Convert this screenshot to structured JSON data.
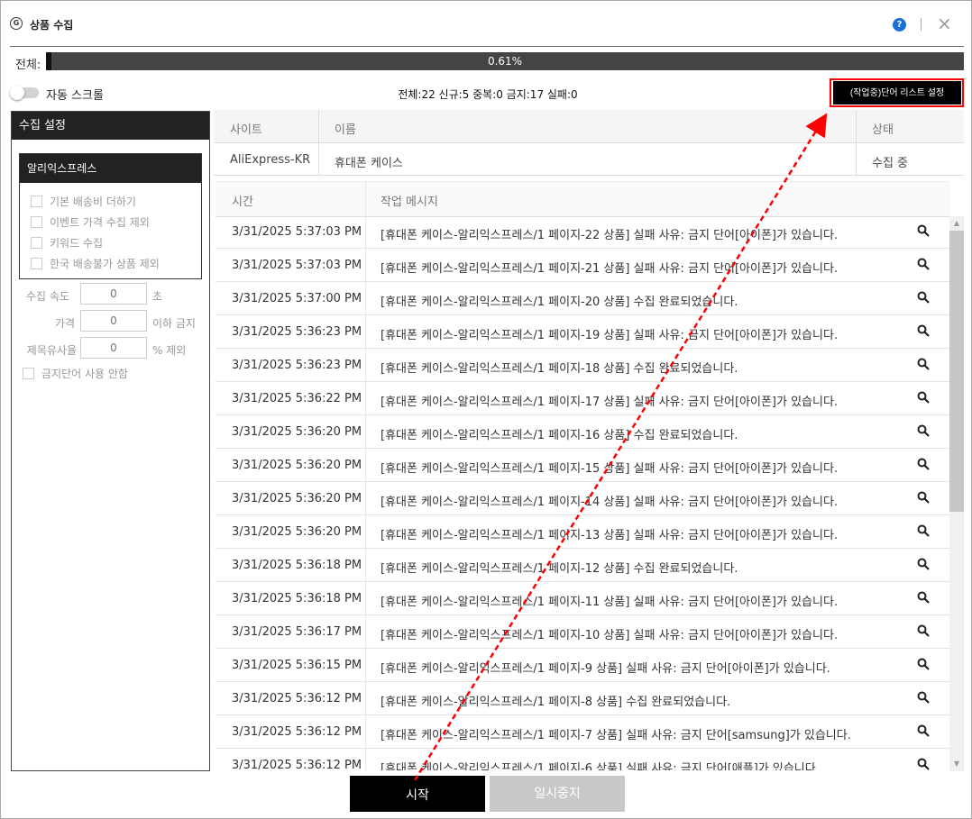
{
  "window": {
    "title": "상품 수집",
    "help_icon": "?",
    "close_icon": "×"
  },
  "progress": {
    "label": "전체:",
    "percent_text": "0.61%",
    "fraction": 0.0061
  },
  "toolbar": {
    "auto_scroll_label": "자동 스크롤",
    "auto_scroll_on": false,
    "stats": "전체:22 신규:5 중복:0 금지:17 실패:0",
    "wordlist_button": "(작업중)단어 리스트 설정"
  },
  "settings": {
    "title": "수집 설정",
    "source_title": "알리익스프레스",
    "options": [
      "기본 배송비 더하기",
      "이벤트 가격 수집 제외",
      "키워드 수집",
      "한국 배송불가 상품 제외"
    ],
    "fields": [
      {
        "label": "수집 속도",
        "value": "0",
        "unit": "초"
      },
      {
        "label": "가격",
        "value": "0",
        "unit": "이하 금지"
      },
      {
        "label": "제목유사율",
        "value": "0",
        "unit": "% 제외"
      }
    ],
    "disable_banned": "금지단어 사용 안함"
  },
  "site_table": {
    "headers": {
      "site": "사이트",
      "name": "이름",
      "status": "상태"
    },
    "row": {
      "site": "AliExpress-KR",
      "name": "휴대폰 케이스",
      "status": "수집 중"
    }
  },
  "log_table": {
    "headers": {
      "time": "시간",
      "message": "작업 메시지"
    },
    "rows": [
      {
        "time": "3/31/2025 5:37:03 PM",
        "message": "[휴대폰 케이스-알리익스프레스/1 페이지-22 상품] 실패 사유: 금지 단어[아이폰]가 있습니다."
      },
      {
        "time": "3/31/2025 5:37:03 PM",
        "message": "[휴대폰 케이스-알리익스프레스/1 페이지-21 상품] 실패 사유: 금지 단어[아이폰]가 있습니다."
      },
      {
        "time": "3/31/2025 5:37:00 PM",
        "message": "[휴대폰 케이스-알리익스프레스/1 페이지-20 상품] 수집 완료되었습니다."
      },
      {
        "time": "3/31/2025 5:36:23 PM",
        "message": "[휴대폰 케이스-알리익스프레스/1 페이지-19 상품] 실패 사유: 금지 단어[아이폰]가 있습니다."
      },
      {
        "time": "3/31/2025 5:36:23 PM",
        "message": "[휴대폰 케이스-알리익스프레스/1 페이지-18 상품] 수집 완료되었습니다."
      },
      {
        "time": "3/31/2025 5:36:22 PM",
        "message": "[휴대폰 케이스-알리익스프레스/1 페이지-17 상품] 실패 사유: 금지 단어[아이폰]가 있습니다."
      },
      {
        "time": "3/31/2025 5:36:20 PM",
        "message": "[휴대폰 케이스-알리익스프레스/1 페이지-16 상품] 수집 완료되었습니다."
      },
      {
        "time": "3/31/2025 5:36:20 PM",
        "message": "[휴대폰 케이스-알리익스프레스/1 페이지-15 상품] 실패 사유: 금지 단어[아이폰]가 있습니다."
      },
      {
        "time": "3/31/2025 5:36:20 PM",
        "message": "[휴대폰 케이스-알리익스프레스/1 페이지-14 상품] 실패 사유: 금지 단어[아이폰]가 있습니다."
      },
      {
        "time": "3/31/2025 5:36:20 PM",
        "message": "[휴대폰 케이스-알리익스프레스/1 페이지-13 상품] 실패 사유: 금지 단어[아이폰]가 있습니다."
      },
      {
        "time": "3/31/2025 5:36:18 PM",
        "message": "[휴대폰 케이스-알리익스프레스/1 페이지-12 상품] 수집 완료되었습니다."
      },
      {
        "time": "3/31/2025 5:36:18 PM",
        "message": "[휴대폰 케이스-알리익스프레스/1 페이지-11 상품] 실패 사유: 금지 단어[아이폰]가 있습니다."
      },
      {
        "time": "3/31/2025 5:36:17 PM",
        "message": "[휴대폰 케이스-알리익스프레스/1 페이지-10 상품] 실패 사유: 금지 단어[아이폰]가 있습니다."
      },
      {
        "time": "3/31/2025 5:36:15 PM",
        "message": "[휴대폰 케이스-알리익스프레스/1 페이지-9 상품] 실패 사유: 금지 단어[아이폰]가 있습니다."
      },
      {
        "time": "3/31/2025 5:36:12 PM",
        "message": "[휴대폰 케이스-알리익스프레스/1 페이지-8 상품] 수집 완료되었습니다."
      },
      {
        "time": "3/31/2025 5:36:12 PM",
        "message": "[휴대폰 케이스-알리익스프레스/1 페이지-7 상품] 실패 사유: 금지 단어[samsung]가 있습니다."
      },
      {
        "time": "3/31/2025 5:36:12 PM",
        "message": "[휴대폰 케이스-알리익스프레스/1 페이지-6 상품] 실패 사유: 금지 단어[애플]가 있습니다."
      }
    ]
  },
  "buttons": {
    "start": "시작",
    "pause": "일시중지"
  },
  "colors": {
    "accent_dark": "#000000",
    "annotation_red": "#ff0000",
    "help_blue": "#1a6fd8"
  }
}
